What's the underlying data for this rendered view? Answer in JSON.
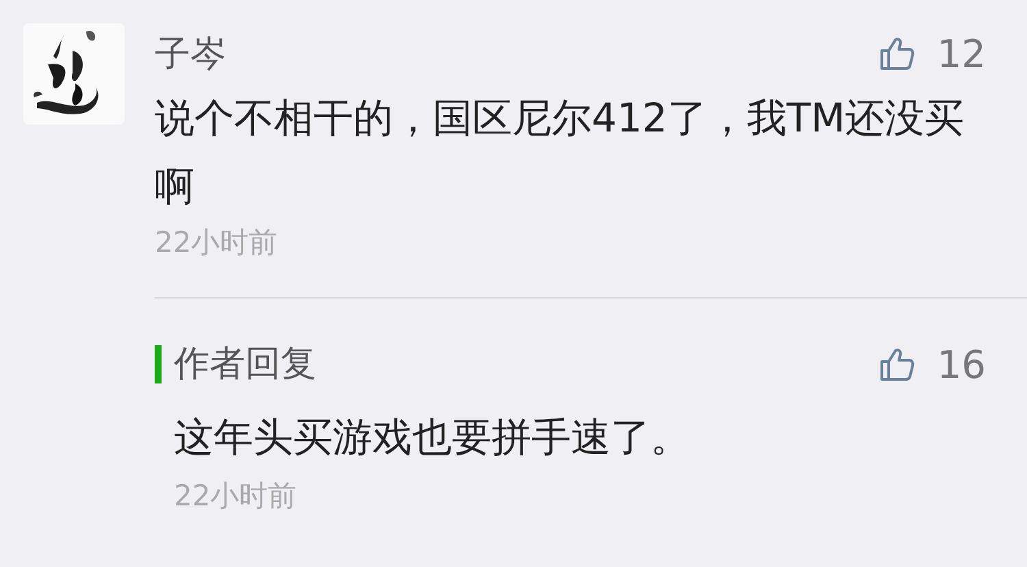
{
  "comments": [
    {
      "author": "子岑",
      "likes": "12",
      "text": "说个不相干的，国区尼尔412了，我TM还没买啊",
      "time": "22小时前",
      "reply": {
        "label": "作者回复",
        "likes": "16",
        "text": "这年头买游戏也要拼手速了。",
        "time": "22小时前"
      }
    }
  ]
}
